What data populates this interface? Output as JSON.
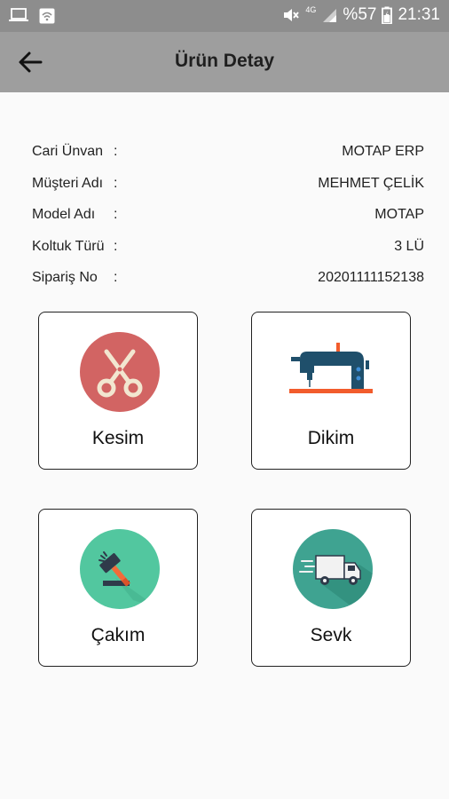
{
  "status_bar": {
    "battery": "%57",
    "time": "21:31",
    "network": "4G"
  },
  "toolbar": {
    "title": "Ürün Detay"
  },
  "info": [
    {
      "label": "Cari Ünvan",
      "colon": ":",
      "value": "MOTAP ERP"
    },
    {
      "label": "Müşteri Adı",
      "colon": ":",
      "value": "MEHMET ÇELİK"
    },
    {
      "label": "Model Adı",
      "colon": ":",
      "value": "MOTAP"
    },
    {
      "label": "Koltuk Türü",
      "colon": ":",
      "value": "3 LÜ"
    },
    {
      "label": "Sipariş No",
      "colon": ":",
      "value": "20201111152138"
    }
  ],
  "actions": [
    {
      "label": "Kesim",
      "icon": "scissors-icon",
      "color": "#d26463"
    },
    {
      "label": "Dikim",
      "icon": "sewing-machine-icon",
      "color": "#1f4f6b"
    },
    {
      "label": "Çakım",
      "icon": "hammer-icon",
      "color": "#52c79f"
    },
    {
      "label": "Sevk",
      "icon": "delivery-truck-icon",
      "color": "#3fa391"
    }
  ]
}
